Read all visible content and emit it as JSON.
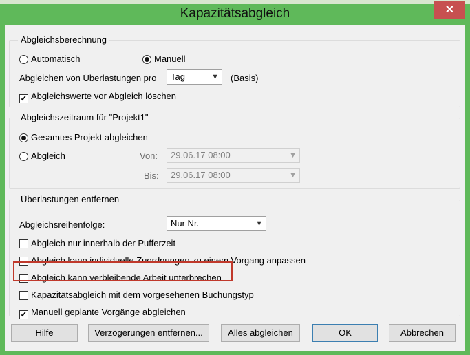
{
  "dialog": {
    "title": "Kapazitätsabgleich",
    "close_glyph": "✕"
  },
  "group_calc": {
    "legend": "Abgleichsberechnung",
    "radio_auto": "Automatisch",
    "radio_manual": "Manuell",
    "overload_label": "Abgleichen von Überlastungen pro",
    "overload_select": "Tag",
    "overload_suffix": "(Basis)",
    "clear_values": "Abgleichswerte vor Abgleich löschen"
  },
  "group_range": {
    "legend": "Abgleichszeitraum für \"Projekt1\"",
    "radio_whole": "Gesamtes Projekt abgleichen",
    "radio_range": "Abgleich",
    "from_label": "Von:",
    "from_value": "29.06.17 08:00",
    "to_label": "Bis:",
    "to_value": "29.06.17 08:00"
  },
  "group_resolve": {
    "legend": "Überlastungen entfernen",
    "order_label": "Abgleichsreihenfolge:",
    "order_select": "Nur Nr.",
    "opt_buffer": "Abgleich nur innerhalb der Pufferzeit",
    "opt_assignments": "Abgleich kann individuelle Zuordnungen zu einem Vorgang anpassen",
    "opt_split": "Abgleich kann verbleibende Arbeit unterbrechen",
    "opt_booking": "Kapazitätsabgleich mit dem vorgesehenen Buchungstyp",
    "opt_manual_tasks": "Manuell geplante Vorgänge abgleichen"
  },
  "state": {
    "mode": "Manuell",
    "clear_values": true,
    "range": "Gesamtes Projekt abgleichen",
    "opt_buffer": false,
    "opt_assignments": false,
    "opt_split": false,
    "opt_booking": false,
    "opt_manual_tasks": true
  },
  "buttons": {
    "help": "Hilfe",
    "remove_delays": "Verzögerungen entfernen...",
    "level_all": "Alles abgleichen",
    "ok": "OK",
    "cancel": "Abbrechen"
  },
  "icons": {
    "dropdown": "chevron-down-icon",
    "close": "close-icon",
    "check": "checkmark-icon"
  },
  "colors": {
    "title_bar": "#5fb95a",
    "close_button": "#c75050",
    "highlight": "#c0392b",
    "default_button_border": "#3c7fb1"
  }
}
